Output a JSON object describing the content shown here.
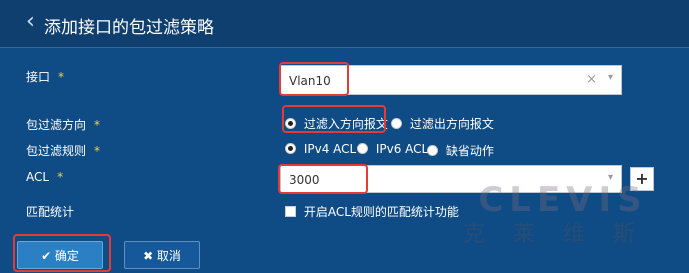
{
  "header": {
    "back_icon": "chevron-left-icon",
    "title": "添加接口的包过滤策略"
  },
  "form": {
    "interface": {
      "label": "接口",
      "value": "Vlan10",
      "clear": "×",
      "caret": "▾"
    },
    "direction": {
      "label": "包过滤方向",
      "options": [
        {
          "label": "过滤入方向报文",
          "selected": true
        },
        {
          "label": "过滤出方向报文",
          "selected": false
        }
      ]
    },
    "rule": {
      "label": "包过滤规则",
      "options": [
        {
          "label": "IPv4 ACL",
          "selected": true
        },
        {
          "label": "IPv6 ACL",
          "selected": false
        },
        {
          "label": "缺省动作",
          "selected": false
        }
      ]
    },
    "acl": {
      "label": "ACL",
      "value": "3000",
      "caret": "▾",
      "add": "+"
    },
    "stats": {
      "label": "匹配统计",
      "checkbox_label": "开启ACL规则的匹配统计功能",
      "checked": false
    },
    "required_mark": "*"
  },
  "buttons": {
    "ok": "✔ 确定",
    "cancel": "✖ 取消"
  },
  "watermark": {
    "en": "CLEVIS",
    "cn": "克莱维斯"
  },
  "colors": {
    "background": "#0f4b84",
    "highlight": "#e63a36",
    "required": "#f2d14b"
  }
}
